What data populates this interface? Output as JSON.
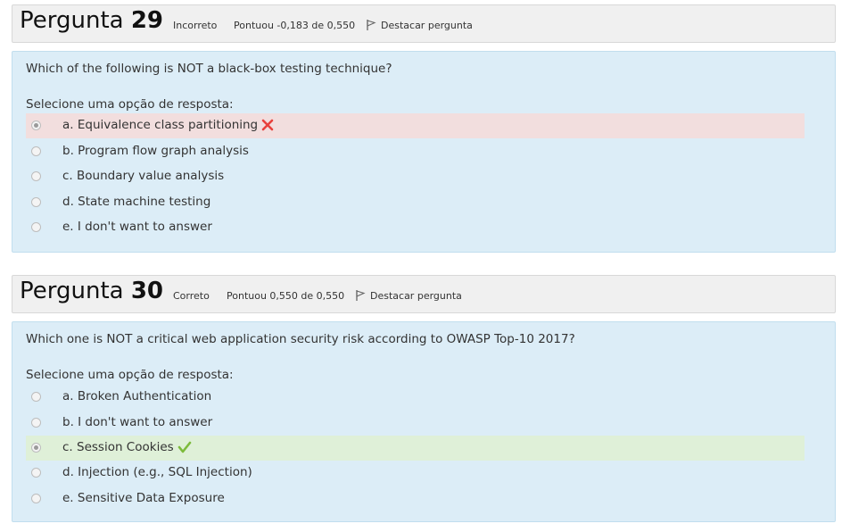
{
  "questions": [
    {
      "title_word": "Pergunta",
      "number": "29",
      "status": "Incorreto",
      "score": "Pontuou -0,183 de 0,550",
      "flag_label": "Destacar pergunta",
      "question": "Which of the following is NOT a black-box testing technique?",
      "prompt": "Selecione uma opção de resposta:",
      "answers": [
        {
          "label": "a. Equivalence class partitioning",
          "selected": true,
          "result": "incorrect"
        },
        {
          "label": "b. Program flow graph analysis",
          "selected": false
        },
        {
          "label": "c. Boundary value analysis",
          "selected": false
        },
        {
          "label": "d. State machine testing",
          "selected": false
        },
        {
          "label": "e. I don't want to answer",
          "selected": false
        }
      ]
    },
    {
      "title_word": "Pergunta",
      "number": "30",
      "status": "Correto",
      "score": "Pontuou 0,550 de 0,550",
      "flag_label": "Destacar pergunta",
      "question": "Which one is NOT a critical web application security risk according to OWASP Top-10 2017?",
      "prompt": "Selecione uma opção de resposta:",
      "answers": [
        {
          "label": "a. Broken Authentication",
          "selected": false
        },
        {
          "label": "b. I don't want to answer",
          "selected": false
        },
        {
          "label": "c. Session Cookies",
          "selected": true,
          "result": "correct"
        },
        {
          "label": "d. Injection (e.g., SQL Injection)",
          "selected": false
        },
        {
          "label": "e. Sensitive Data Exposure",
          "selected": false
        }
      ]
    }
  ],
  "icons": {
    "flag": "flag-icon",
    "incorrect_mark": "cross-icon",
    "correct_mark": "checkmark-icon"
  },
  "colors": {
    "incorrect_bg": "#f2dede",
    "correct_bg": "#dff0d8",
    "question_bg": "#dcedf7",
    "header_bg": "#f0f0f0",
    "cross": "#e8413c",
    "check": "#7dbb3c"
  }
}
